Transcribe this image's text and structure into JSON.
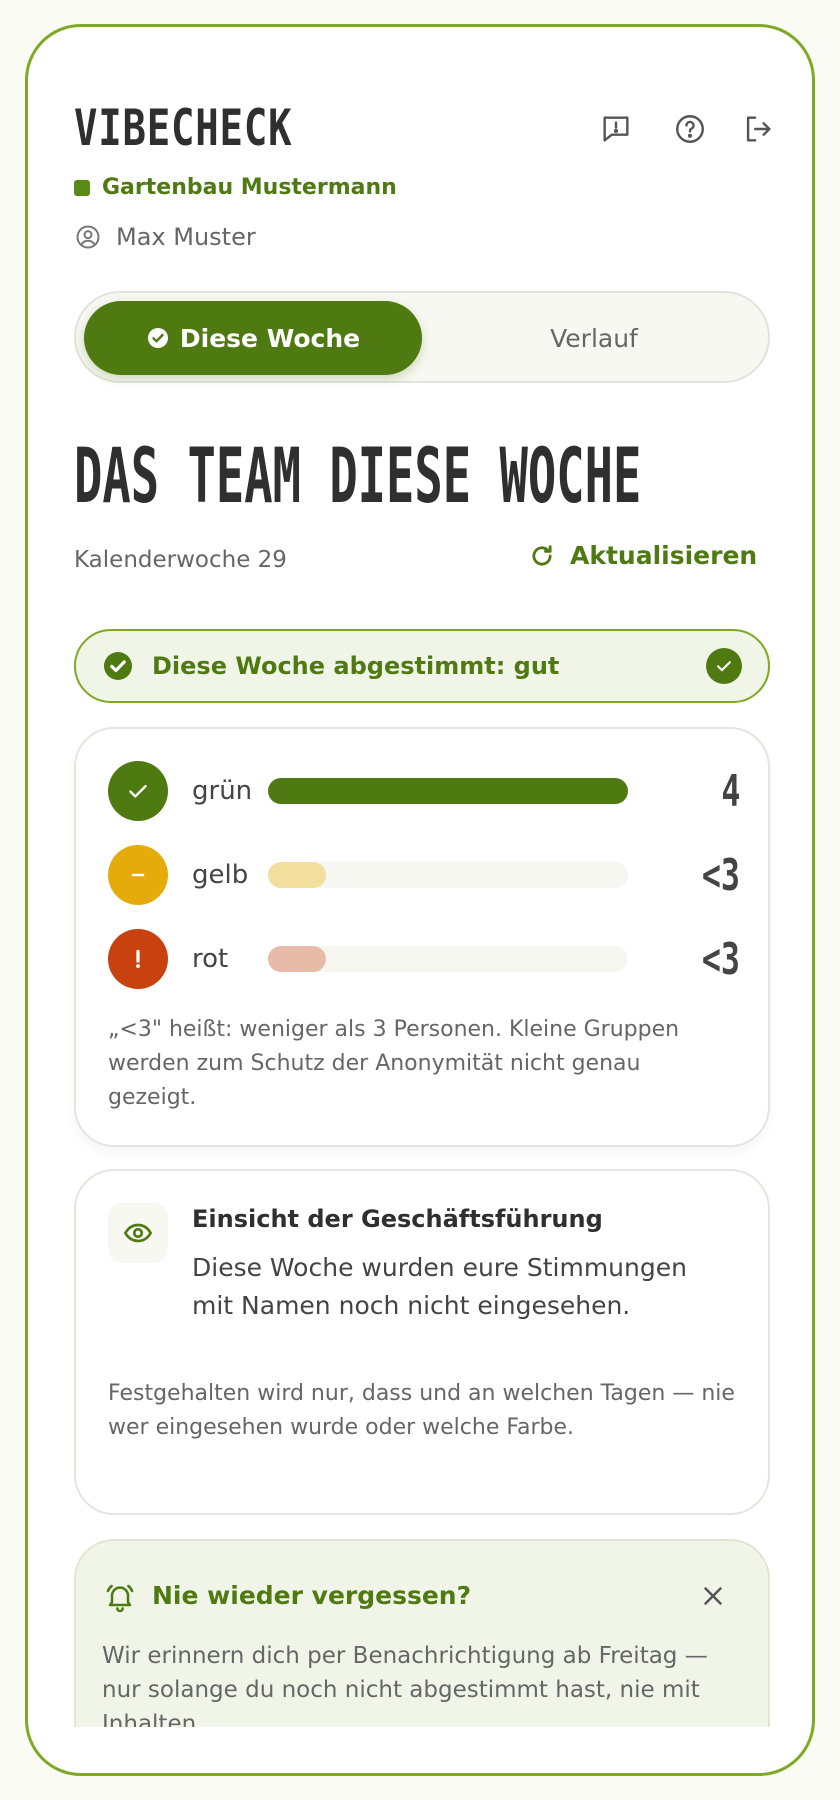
{
  "app": {
    "brand": "VIBECHECK"
  },
  "header": {
    "icons": [
      "feedback-icon",
      "help-icon",
      "logout-icon"
    ]
  },
  "company": {
    "name": "Gartenbau Mustermann"
  },
  "user": {
    "name": "Max Muster"
  },
  "tabs": {
    "active": "Diese Woche",
    "inactive": "Verlauf"
  },
  "main": {
    "title": "DAS TEAM DIESE WOCHE",
    "week": "Kalenderwoche 29",
    "refresh_label": "Aktualisieren",
    "voted_label": "Diese Woche abgestimmt: gut"
  },
  "counts": {
    "rows": [
      {
        "label": "grün",
        "value": "4",
        "fill": 1.0,
        "color": "#4f7a12",
        "track_fill": "#4f7a12"
      },
      {
        "label": "gelb",
        "value": "<3",
        "fill": 0.16,
        "color": "#e5ab0a",
        "track_fill": "#f2df9e"
      },
      {
        "label": "rot",
        "value": "<3",
        "fill": 0.16,
        "color": "#c8420f",
        "track_fill": "#e8bba8"
      }
    ],
    "note": "„<3\" heißt: weniger als 3 Personen. Kleine Gruppen werden zum Schutz der Anonymität nicht genau gezeigt."
  },
  "insight": {
    "title": "Einsicht der Geschäftsführung",
    "body": "Diese Woche wurden eure Stimmungen mit Namen noch nicht eingesehen.",
    "note": "Festgehalten wird nur, dass und an welchen Tagen — nie wer eingesehen wurde oder welche Farbe."
  },
  "reminder": {
    "title": "Nie wieder vergessen?",
    "body": "Wir erinnern dich per Benachrichtigung ab Freitag — nur solange du noch nicht abgestimmt hast, nie mit Inhalten."
  },
  "colors": {
    "accent": "#4f7a12",
    "frame": "#7fa923"
  }
}
